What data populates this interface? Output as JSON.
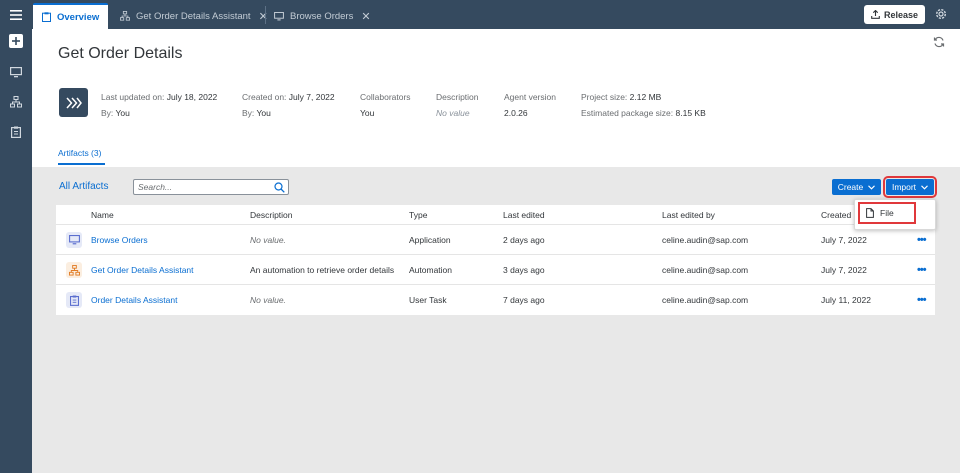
{
  "colors": {
    "shell": "#354a5f",
    "accent": "#0a6ed1",
    "highlight": "#e0383b"
  },
  "sidebar": {
    "icons": [
      "menu-icon",
      "add-icon",
      "monitor-icon",
      "hierarchy-icon",
      "clipboard-icon"
    ]
  },
  "tabs": [
    {
      "label": "Overview",
      "icon": "clipboard-icon",
      "active": true
    },
    {
      "label": "Get Order Details Assistant",
      "icon": "hierarchy-icon",
      "active": false
    },
    {
      "label": "Browse Orders",
      "icon": "monitor-icon",
      "active": false
    }
  ],
  "toolbar": {
    "release_label": "Release"
  },
  "project": {
    "title": "Get Order Details",
    "last_updated_label": "Last updated on:",
    "last_updated_value": "July 18, 2022",
    "last_updated_by_label": "By:",
    "last_updated_by_value": "You",
    "created_label": "Created on:",
    "created_value": "July 7, 2022",
    "created_by_label": "By:",
    "created_by_value": "You",
    "collaborators_label": "Collaborators",
    "collaborators_value": "You",
    "description_label": "Description",
    "description_value": "No value",
    "agent_version_label": "Agent version",
    "agent_version_value": "2.0.26",
    "project_size_label": "Project size:",
    "project_size_value": "2.12 MB",
    "package_size_label": "Estimated package size:",
    "package_size_value": "8.15 KB"
  },
  "artifacts_tab": "Artifacts (3)",
  "content": {
    "section_title": "All Artifacts",
    "search_placeholder": "Search...",
    "create_label": "Create",
    "import_label": "Import",
    "import_menu": {
      "file_label": "File"
    }
  },
  "table": {
    "headers": {
      "name": "Name",
      "description": "Description",
      "type": "Type",
      "last_edited": "Last edited",
      "last_edited_by": "Last edited by",
      "created": "Created"
    },
    "rows": [
      {
        "icon": "monitor-icon",
        "name": "Browse Orders",
        "description": "No value.",
        "type": "Application",
        "last_edited": "2 days ago",
        "last_edited_by": "celine.audin@sap.com",
        "created": "July 7, 2022"
      },
      {
        "icon": "hierarchy-icon",
        "name": "Get Order Details Assistant",
        "description": "An automation to retrieve order details",
        "type": "Automation",
        "last_edited": "3 days ago",
        "last_edited_by": "celine.audin@sap.com",
        "created": "July 7, 2022"
      },
      {
        "icon": "clipboard-icon",
        "name": "Order Details Assistant",
        "description": "No value.",
        "type": "User Task",
        "last_edited": "7 days ago",
        "last_edited_by": "celine.audin@sap.com",
        "created": "July 11, 2022"
      }
    ]
  }
}
